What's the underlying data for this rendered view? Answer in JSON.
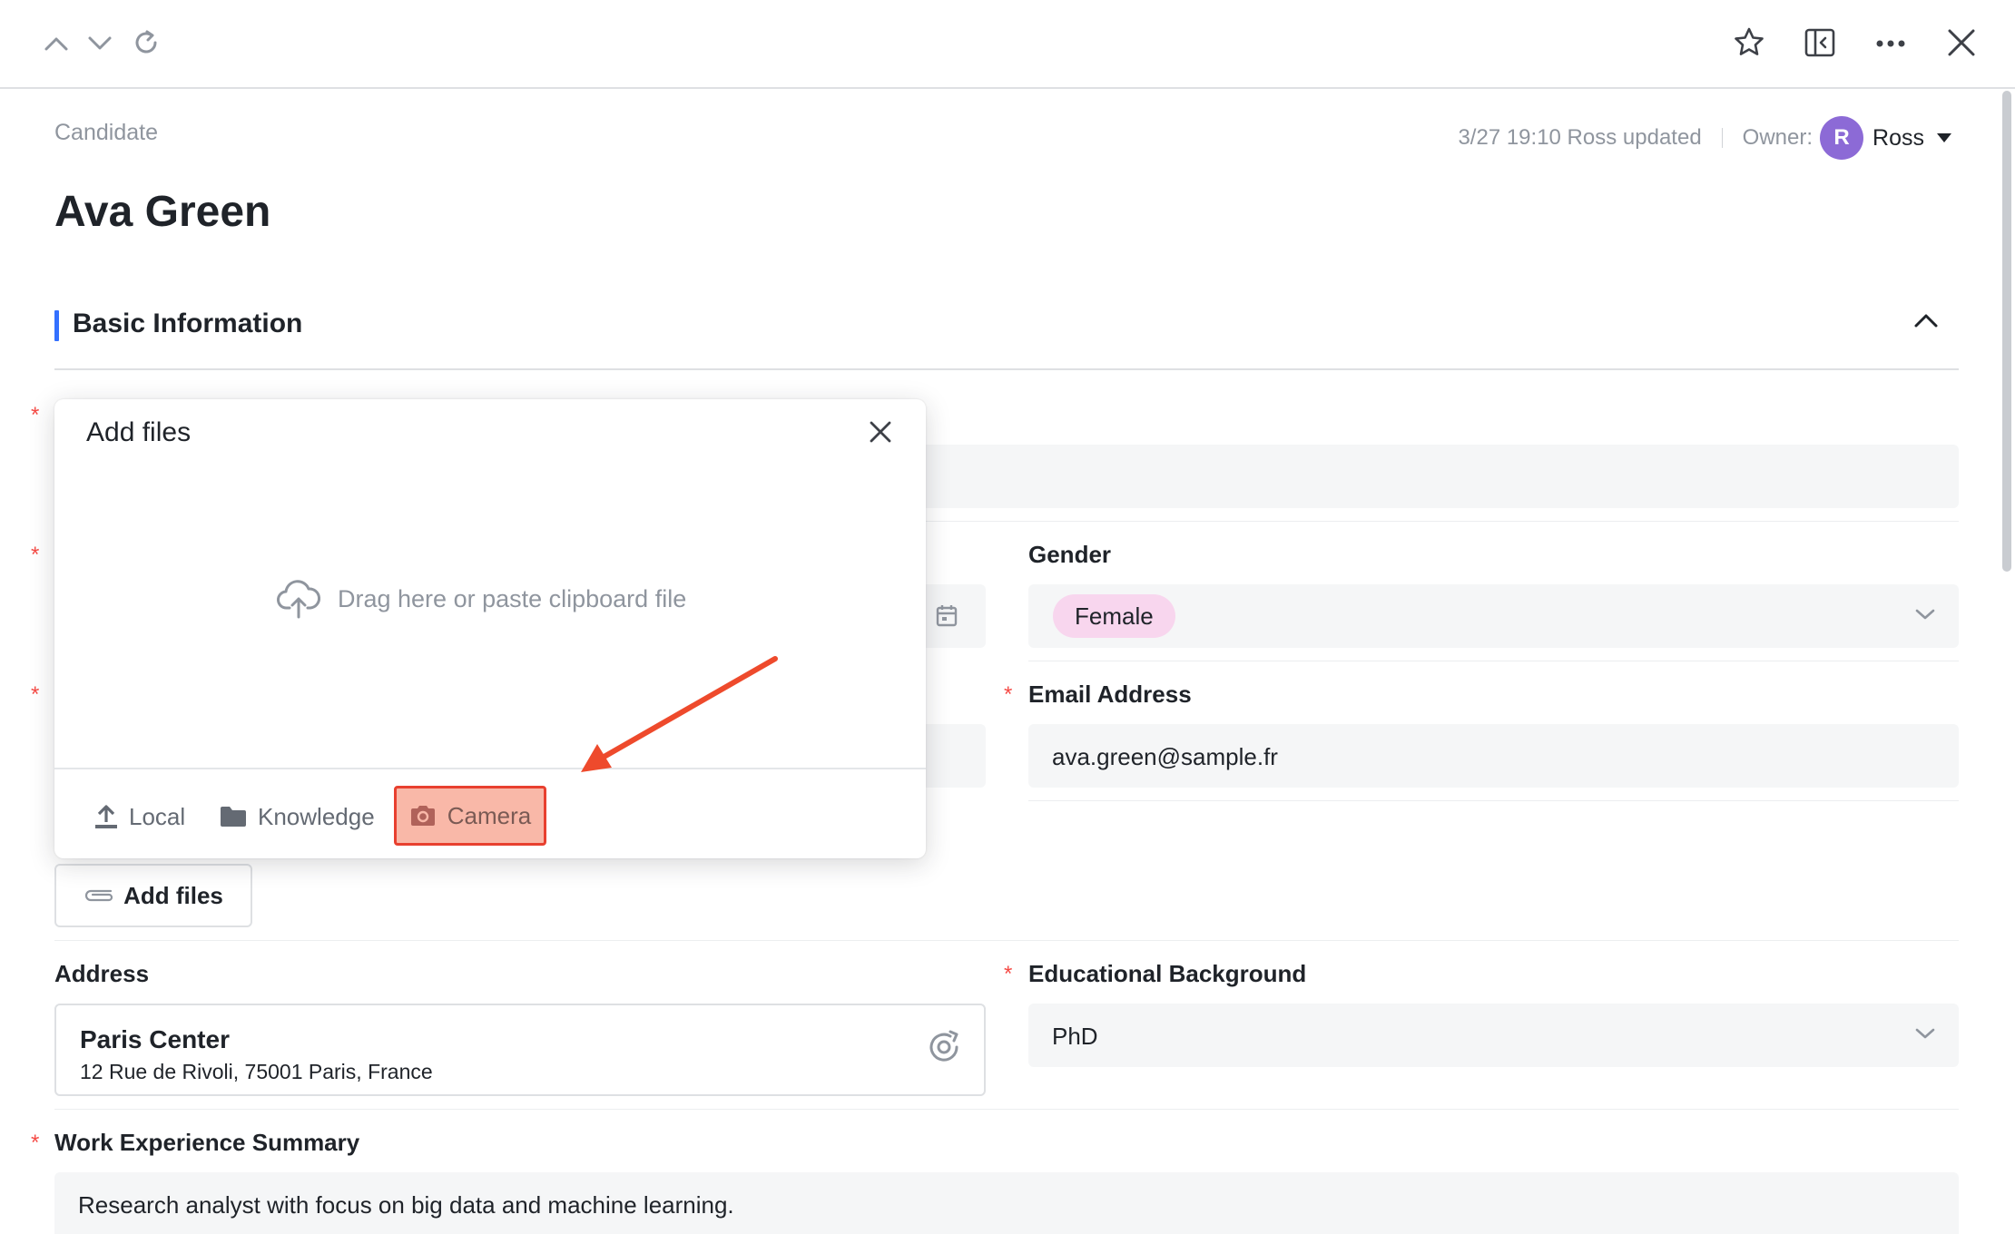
{
  "toolbar": {
    "icons": [
      "chevron-up-icon",
      "chevron-down-icon",
      "refresh-icon",
      "star-icon",
      "sidebar-collapse-icon",
      "more-icon",
      "close-icon"
    ]
  },
  "record": {
    "breadcrumb": "Candidate",
    "title": "Ava Green",
    "updated_text": "3/27 19:10 Ross updated",
    "owner_label": "Owner:",
    "owner_initial": "R",
    "owner_name": "Ross"
  },
  "section": {
    "title": "Basic Information"
  },
  "fields": {
    "gender": {
      "label": "Gender",
      "value": "Female"
    },
    "email": {
      "label": "Email Address",
      "value": "ava.green@sample.fr",
      "required": "*"
    },
    "address": {
      "label": "Address",
      "name": "Paris Center",
      "line": "12 Rue de Rivoli, 75001 Paris, France"
    },
    "education": {
      "label": "Educational Background",
      "value": "PhD",
      "required": "*"
    },
    "work_summary": {
      "label": "Work Experience Summary",
      "value": "Research analyst with focus on big data and machine learning.",
      "required": "*"
    },
    "attachments": {
      "button_label": "Add files"
    },
    "required_marker": "*"
  },
  "popup": {
    "title": "Add files",
    "drop_text": "Drag here or paste clipboard file",
    "sources": {
      "local": "Local",
      "knowledge": "Knowledge",
      "camera": "Camera"
    }
  },
  "colors": {
    "accent": "#3370ff",
    "required": "#f54a45",
    "highlight_fill": "#f9b8a8",
    "highlight_border": "#e8402f",
    "arrow": "#ee4a2c",
    "tag_female": "#f8d6ee",
    "avatar": "#8c6ad6"
  }
}
